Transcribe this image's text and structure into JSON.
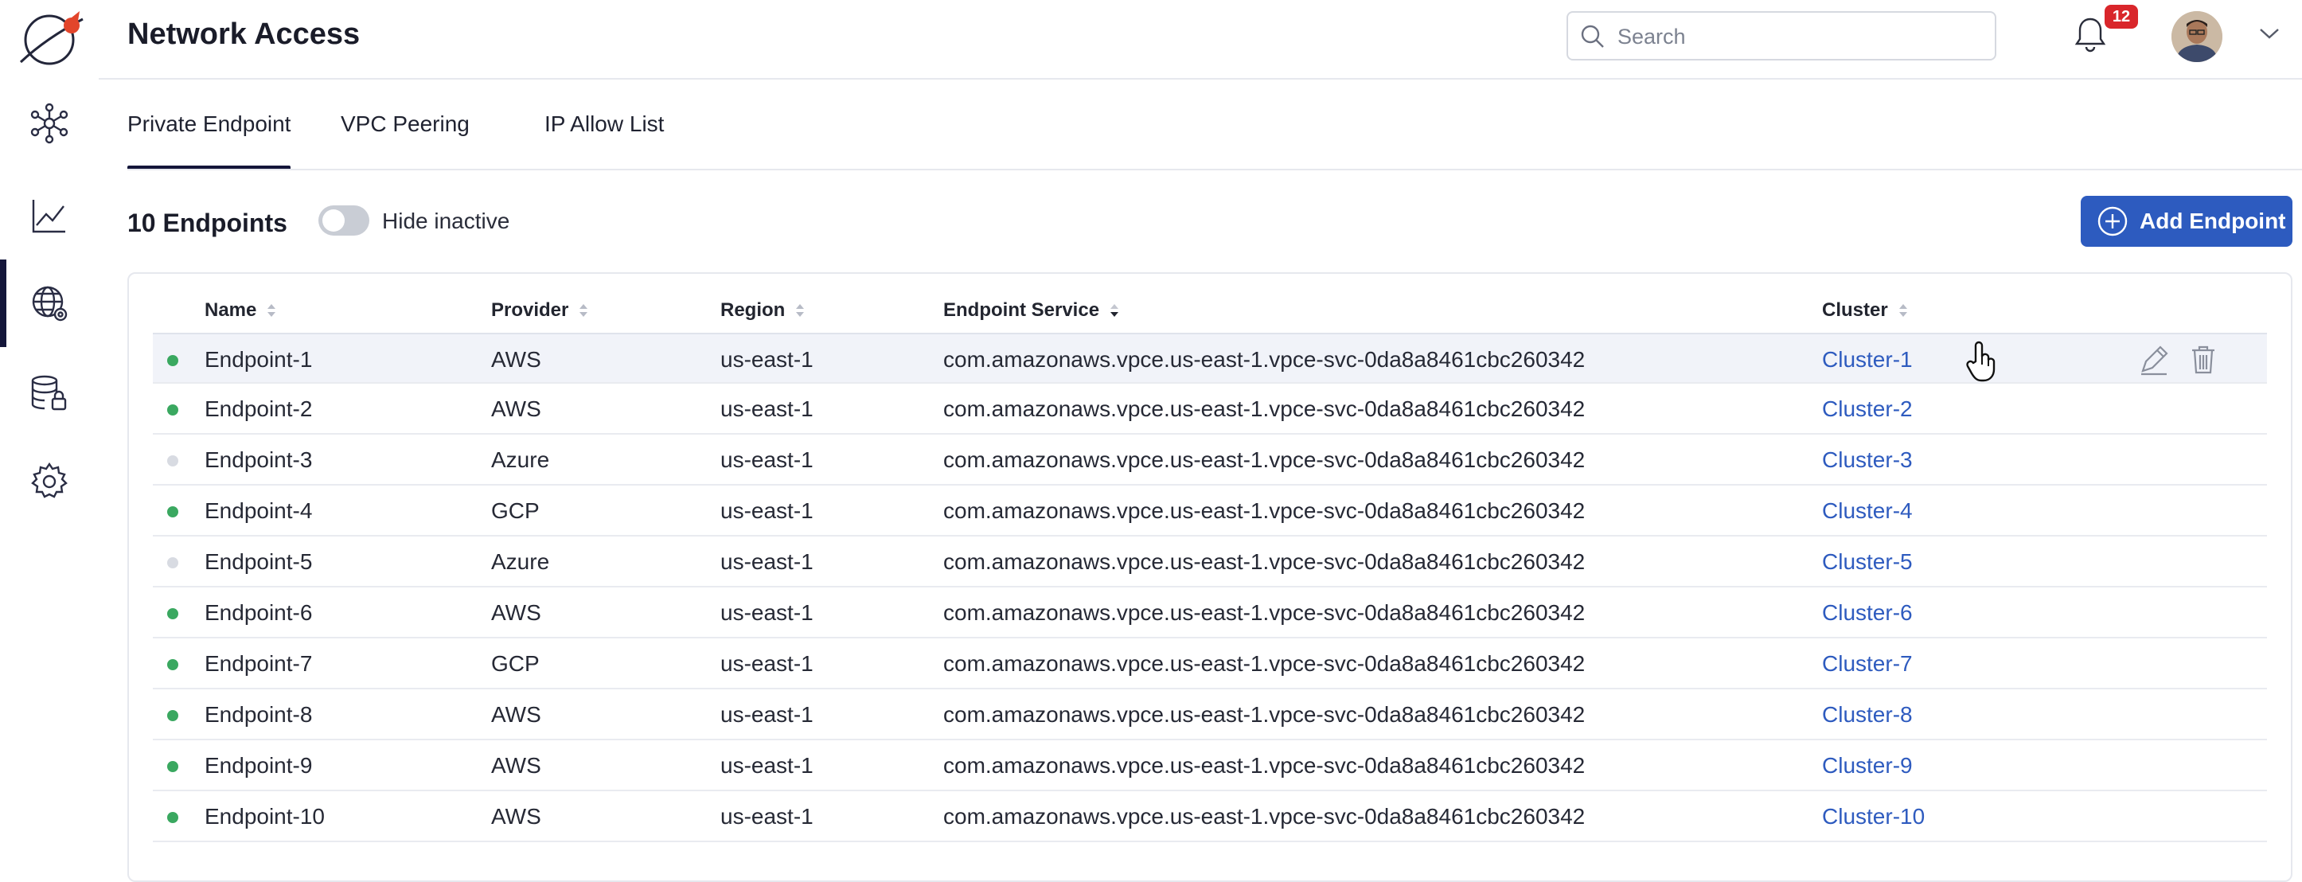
{
  "header": {
    "title": "Network Access"
  },
  "search": {
    "placeholder": "Search",
    "value": ""
  },
  "notifications": {
    "count": "12"
  },
  "sidebar": {
    "items": [
      {
        "name": "topology",
        "icon": "network-hub-icon",
        "active": false
      },
      {
        "name": "analytics",
        "icon": "line-chart-icon",
        "active": false
      },
      {
        "name": "network",
        "icon": "globe-gear-icon",
        "active": true
      },
      {
        "name": "databases",
        "icon": "database-lock-icon",
        "active": false
      },
      {
        "name": "settings",
        "icon": "gear-icon",
        "active": false
      }
    ]
  },
  "tabs": [
    {
      "label": "Private Endpoint",
      "active": true
    },
    {
      "label": "VPC Peering",
      "active": false
    },
    {
      "label": "IP Allow List",
      "active": false
    }
  ],
  "toolbar": {
    "count_label": "10 Endpoints",
    "toggle_label": "Hide inactive",
    "toggle_on": false,
    "add_button_label": "Add Endpoint"
  },
  "table": {
    "columns": [
      "Name",
      "Provider",
      "Region",
      "Endpoint Service",
      "Cluster"
    ],
    "rows": [
      {
        "active": true,
        "name": "Endpoint-1",
        "provider": "AWS",
        "region": "us-east-1",
        "service": "com.amazonaws.vpce.us-east-1.vpce-svc-0da8a8461cbc260342",
        "cluster": "Cluster-1"
      },
      {
        "active": true,
        "name": "Endpoint-2",
        "provider": "AWS",
        "region": "us-east-1",
        "service": "com.amazonaws.vpce.us-east-1.vpce-svc-0da8a8461cbc260342",
        "cluster": "Cluster-2"
      },
      {
        "active": false,
        "name": "Endpoint-3",
        "provider": "Azure",
        "region": "us-east-1",
        "service": "com.amazonaws.vpce.us-east-1.vpce-svc-0da8a8461cbc260342",
        "cluster": "Cluster-3"
      },
      {
        "active": true,
        "name": "Endpoint-4",
        "provider": "GCP",
        "region": "us-east-1",
        "service": "com.amazonaws.vpce.us-east-1.vpce-svc-0da8a8461cbc260342",
        "cluster": "Cluster-4"
      },
      {
        "active": false,
        "name": "Endpoint-5",
        "provider": "Azure",
        "region": "us-east-1",
        "service": "com.amazonaws.vpce.us-east-1.vpce-svc-0da8a8461cbc260342",
        "cluster": "Cluster-5"
      },
      {
        "active": true,
        "name": "Endpoint-6",
        "provider": "AWS",
        "region": "us-east-1",
        "service": "com.amazonaws.vpce.us-east-1.vpce-svc-0da8a8461cbc260342",
        "cluster": "Cluster-6"
      },
      {
        "active": true,
        "name": "Endpoint-7",
        "provider": "GCP",
        "region": "us-east-1",
        "service": "com.amazonaws.vpce.us-east-1.vpce-svc-0da8a8461cbc260342",
        "cluster": "Cluster-7"
      },
      {
        "active": true,
        "name": "Endpoint-8",
        "provider": "AWS",
        "region": "us-east-1",
        "service": "com.amazonaws.vpce.us-east-1.vpce-svc-0da8a8461cbc260342",
        "cluster": "Cluster-8"
      },
      {
        "active": true,
        "name": "Endpoint-9",
        "provider": "AWS",
        "region": "us-east-1",
        "service": "com.amazonaws.vpce.us-east-1.vpce-svc-0da8a8461cbc260342",
        "cluster": "Cluster-9"
      },
      {
        "active": true,
        "name": "Endpoint-10",
        "provider": "AWS",
        "region": "us-east-1",
        "service": "com.amazonaws.vpce.us-east-1.vpce-svc-0da8a8461cbc260342",
        "cluster": "Cluster-10"
      }
    ]
  },
  "colors": {
    "accent": "#2d5bbf",
    "active_dot": "#3aa860",
    "inactive_dot": "#d8dbe2",
    "badge": "#d9262b",
    "nav_active": "#14163a"
  }
}
